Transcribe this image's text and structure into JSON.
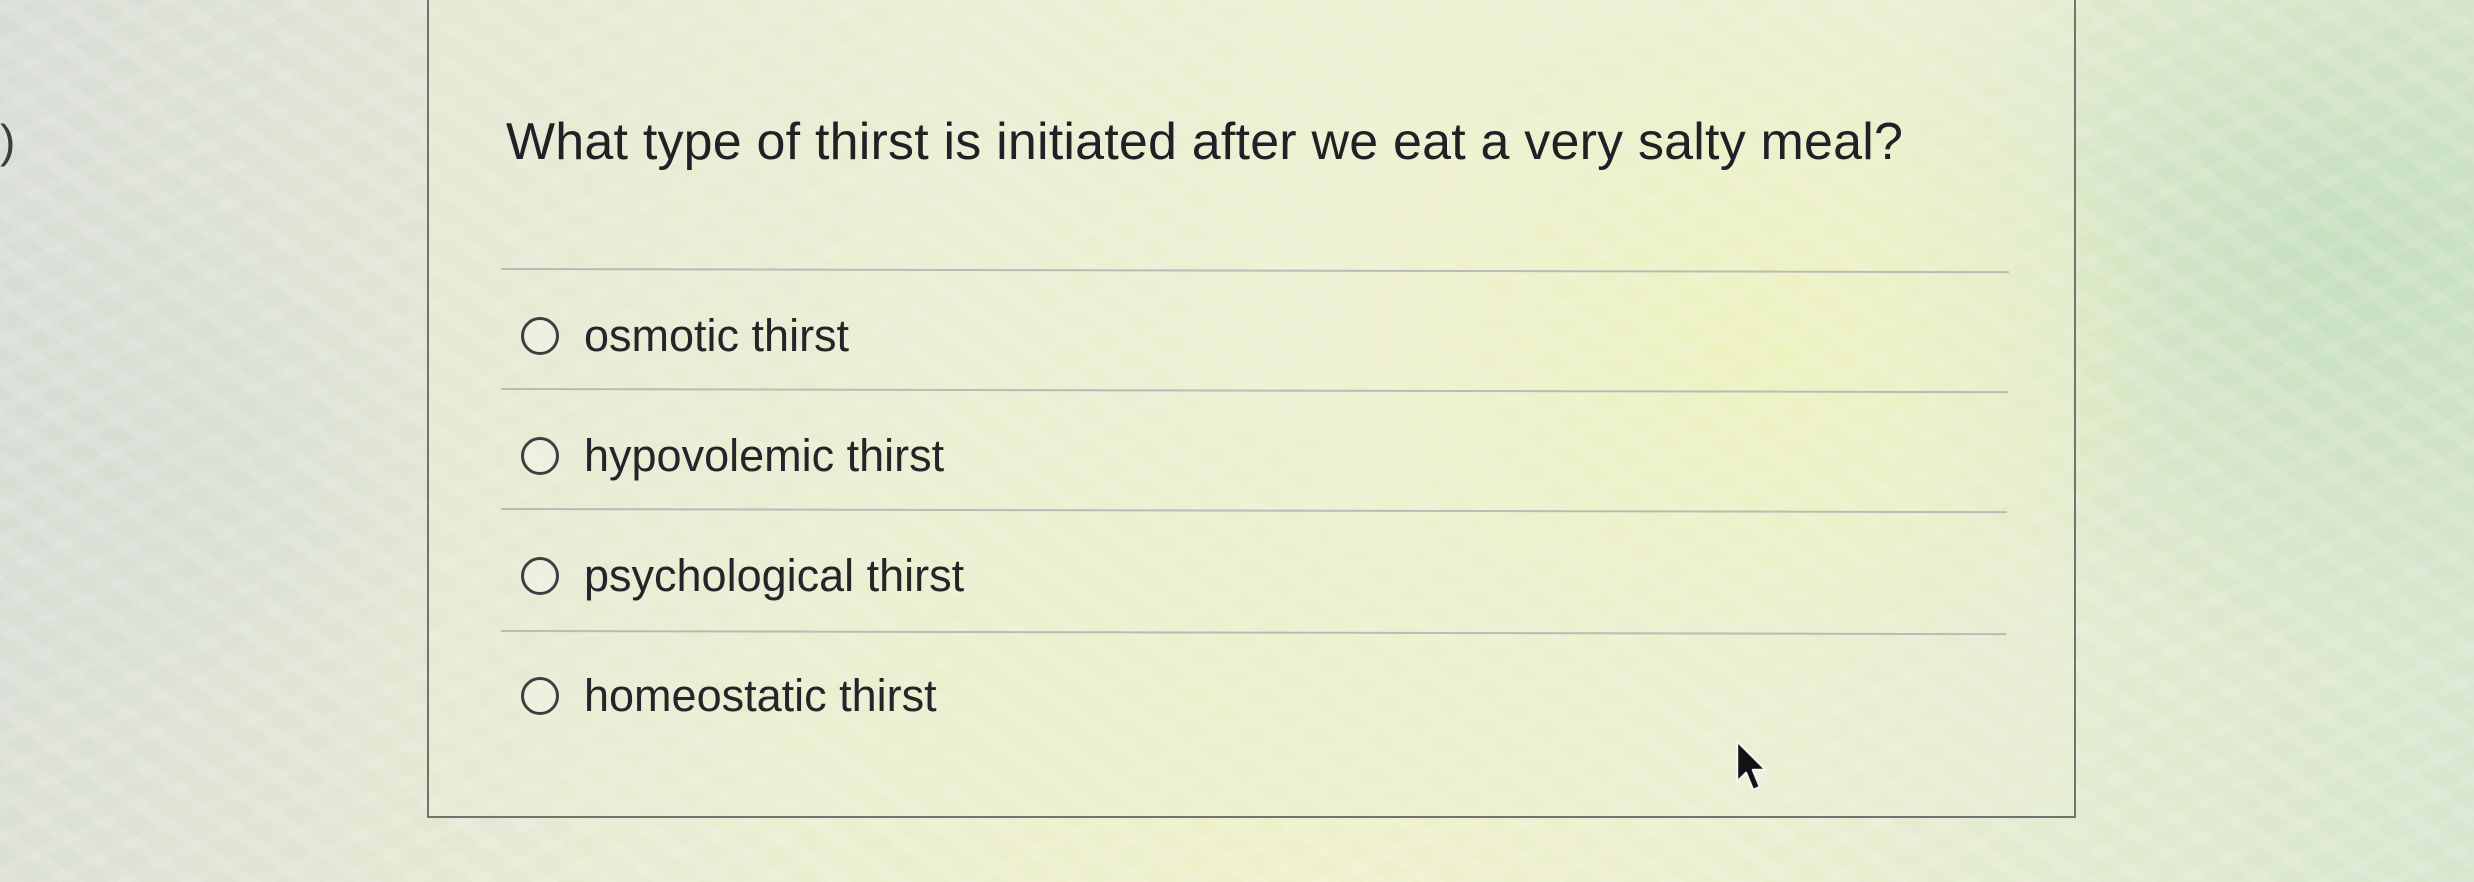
{
  "edge_glyph": ")",
  "question": {
    "text": "What type of thirst is initiated after we eat a very salty meal?"
  },
  "options": [
    {
      "label": "osmotic thirst",
      "selected": false
    },
    {
      "label": "hypovolemic thirst",
      "selected": false
    },
    {
      "label": "psychological thirst",
      "selected": false
    },
    {
      "label": "homeostatic thirst",
      "selected": false
    }
  ],
  "cursor": {
    "icon": "arrow-pointer-icon"
  }
}
